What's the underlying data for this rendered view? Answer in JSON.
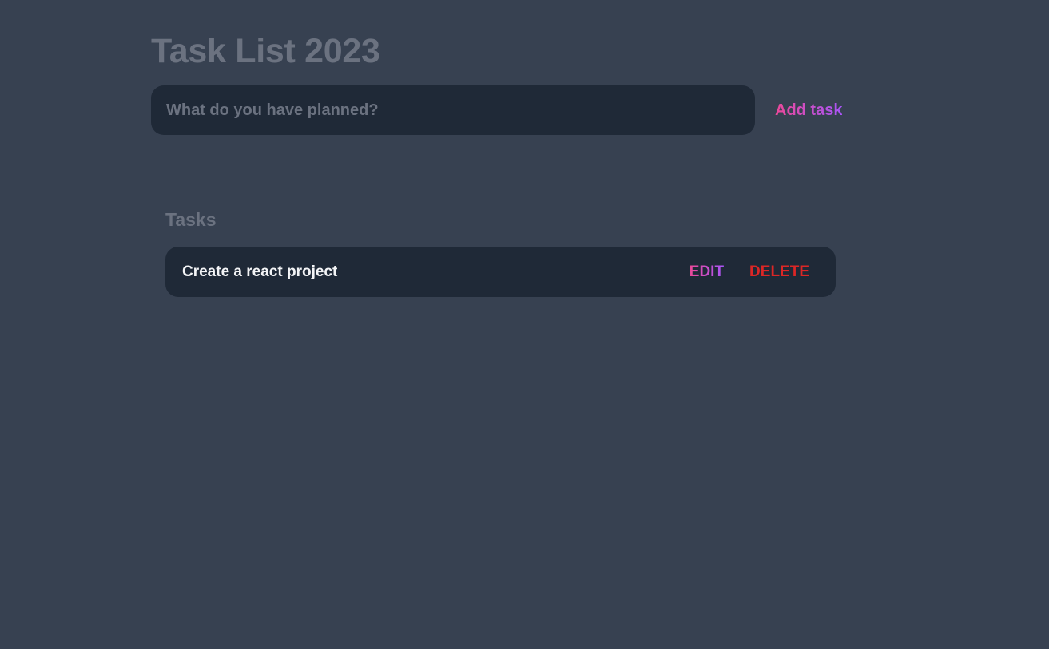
{
  "header": {
    "title": "Task List 2023"
  },
  "new_task_form": {
    "input_value": "",
    "input_placeholder": "What do you have planned?",
    "submit_label": "Add task"
  },
  "tasks": {
    "heading": "Tasks",
    "items": [
      {
        "text": "Create a react project",
        "edit_label": "EDIT",
        "delete_label": "DELETE"
      }
    ]
  },
  "colors": {
    "background": "#374151",
    "panel": "#1f2937",
    "muted_text": "#6b7280",
    "accent_gradient_start": "#ec4899",
    "accent_gradient_end": "#a855f7",
    "danger": "#dc2626"
  }
}
